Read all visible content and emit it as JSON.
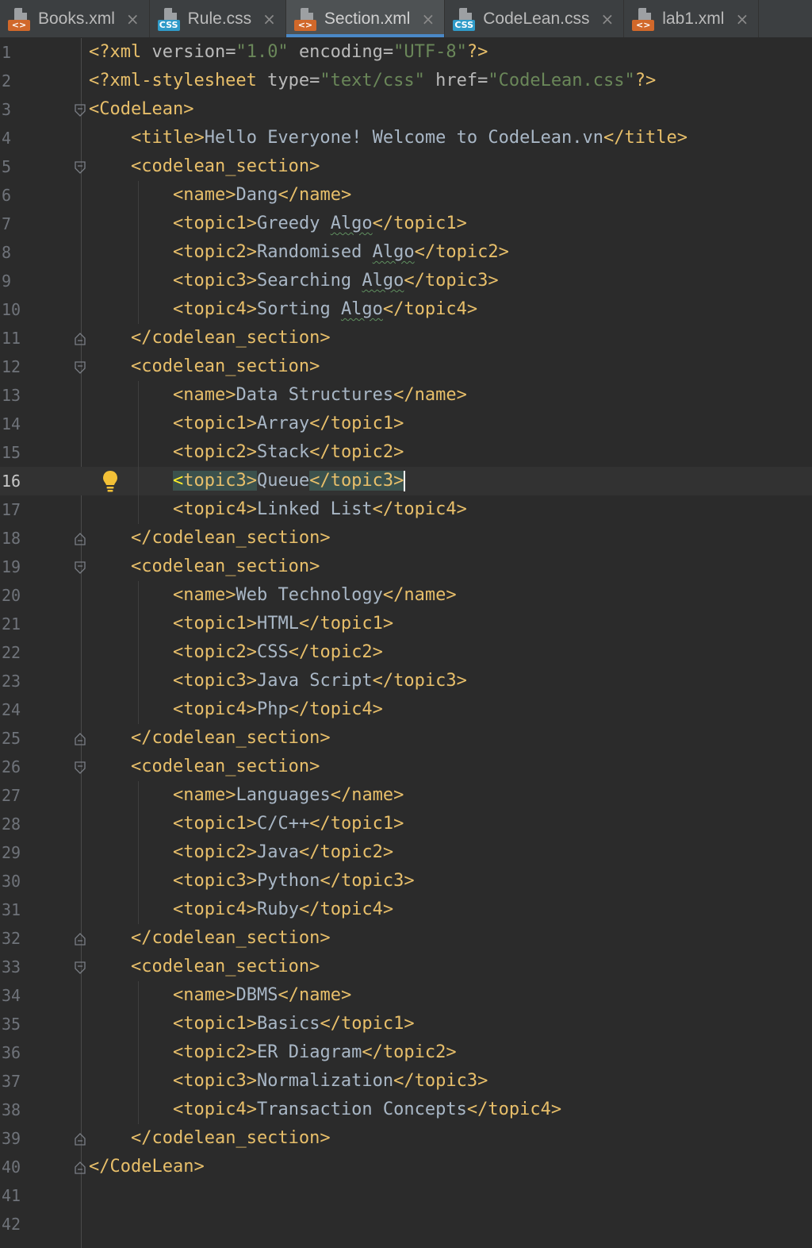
{
  "tabs": [
    {
      "label": "Books.xml",
      "type": "xml",
      "active": false
    },
    {
      "label": "Rule.css",
      "type": "css",
      "active": false
    },
    {
      "label": "Section.xml",
      "type": "xml",
      "active": true
    },
    {
      "label": "CodeLean.css",
      "type": "css",
      "active": false
    },
    {
      "label": "lab1.xml",
      "type": "xml",
      "active": false
    }
  ],
  "tab_badges": {
    "xml": "<>",
    "css": "CSS"
  },
  "close_glyph": "×",
  "colors": {
    "tag": "#e8bf6a",
    "text": "#a9b7c6",
    "value": "#6a8759",
    "accent": "#4a88c7",
    "match_highlight": "#3b514d"
  },
  "editor": {
    "current_line": 16,
    "lines": [
      {
        "n": "1",
        "indent": 0,
        "raw": "<?xml version=\"1.0\" encoding=\"UTF-8\"?>"
      },
      {
        "n": "2",
        "indent": 0,
        "raw": "<?xml-stylesheet type=\"text/css\" href=\"CodeLean.css\"?>"
      },
      {
        "n": "3",
        "indent": 0,
        "raw": "<CodeLean>",
        "fold": "open"
      },
      {
        "n": "4",
        "indent": 1,
        "raw": "<title>Hello Everyone! Welcome to CodeLean.vn</title>"
      },
      {
        "n": "5",
        "indent": 1,
        "raw": "<codelean_section>",
        "fold": "open"
      },
      {
        "n": "6",
        "indent": 2,
        "raw": "<name>Dang</name>"
      },
      {
        "n": "7",
        "indent": 2,
        "raw": "<topic1>Greedy Algo</topic1>",
        "typo": "Algo"
      },
      {
        "n": "8",
        "indent": 2,
        "raw": "<topic2>Randomised Algo</topic2>",
        "typo": "Algo"
      },
      {
        "n": "9",
        "indent": 2,
        "raw": "<topic3>Searching Algo</topic3>",
        "typo": "Algo"
      },
      {
        "n": "10",
        "indent": 2,
        "raw": "<topic4>Sorting Algo</topic4>",
        "typo": "Algo"
      },
      {
        "n": "11",
        "indent": 1,
        "raw": "</codelean_section>",
        "fold": "close"
      },
      {
        "n": "12",
        "indent": 1,
        "raw": "<codelean_section>",
        "fold": "open"
      },
      {
        "n": "13",
        "indent": 2,
        "raw": "<name>Data Structures</name>"
      },
      {
        "n": "14",
        "indent": 2,
        "raw": "<topic1>Array</topic1>"
      },
      {
        "n": "15",
        "indent": 2,
        "raw": "<topic2>Stack</topic2>"
      },
      {
        "n": "16",
        "indent": 2,
        "raw": "<topic3>Queue</topic3>",
        "current": true,
        "bulb": true
      },
      {
        "n": "17",
        "indent": 2,
        "raw": "<topic4>Linked List</topic4>"
      },
      {
        "n": "18",
        "indent": 1,
        "raw": "</codelean_section>",
        "fold": "close"
      },
      {
        "n": "19",
        "indent": 1,
        "raw": "<codelean_section>",
        "fold": "open"
      },
      {
        "n": "20",
        "indent": 2,
        "raw": "<name>Web Technology</name>"
      },
      {
        "n": "21",
        "indent": 2,
        "raw": "<topic1>HTML</topic1>"
      },
      {
        "n": "22",
        "indent": 2,
        "raw": "<topic2>CSS</topic2>"
      },
      {
        "n": "23",
        "indent": 2,
        "raw": "<topic3>Java Script</topic3>"
      },
      {
        "n": "24",
        "indent": 2,
        "raw": "<topic4>Php</topic4>"
      },
      {
        "n": "25",
        "indent": 1,
        "raw": "</codelean_section>",
        "fold": "close"
      },
      {
        "n": "26",
        "indent": 1,
        "raw": "<codelean_section>",
        "fold": "open"
      },
      {
        "n": "27",
        "indent": 2,
        "raw": "<name>Languages</name>"
      },
      {
        "n": "28",
        "indent": 2,
        "raw": "<topic1>C/C++</topic1>"
      },
      {
        "n": "29",
        "indent": 2,
        "raw": "<topic2>Java</topic2>"
      },
      {
        "n": "30",
        "indent": 2,
        "raw": "<topic3>Python</topic3>"
      },
      {
        "n": "31",
        "indent": 2,
        "raw": "<topic4>Ruby</topic4>"
      },
      {
        "n": "32",
        "indent": 1,
        "raw": "</codelean_section>",
        "fold": "close"
      },
      {
        "n": "33",
        "indent": 1,
        "raw": "<codelean_section>",
        "fold": "open"
      },
      {
        "n": "34",
        "indent": 2,
        "raw": "<name>DBMS</name>"
      },
      {
        "n": "35",
        "indent": 2,
        "raw": "<topic1>Basics</topic1>"
      },
      {
        "n": "36",
        "indent": 2,
        "raw": "<topic2>ER Diagram</topic2>"
      },
      {
        "n": "37",
        "indent": 2,
        "raw": "<topic3>Normalization</topic3>"
      },
      {
        "n": "38",
        "indent": 2,
        "raw": "<topic4>Transaction Concepts</topic4>"
      },
      {
        "n": "39",
        "indent": 1,
        "raw": "</codelean_section>",
        "fold": "close"
      },
      {
        "n": "40",
        "indent": 0,
        "raw": "</CodeLean>",
        "fold": "close"
      },
      {
        "n": "41",
        "indent": 0,
        "raw": ""
      },
      {
        "n": "42",
        "indent": 0,
        "raw": ""
      }
    ]
  }
}
